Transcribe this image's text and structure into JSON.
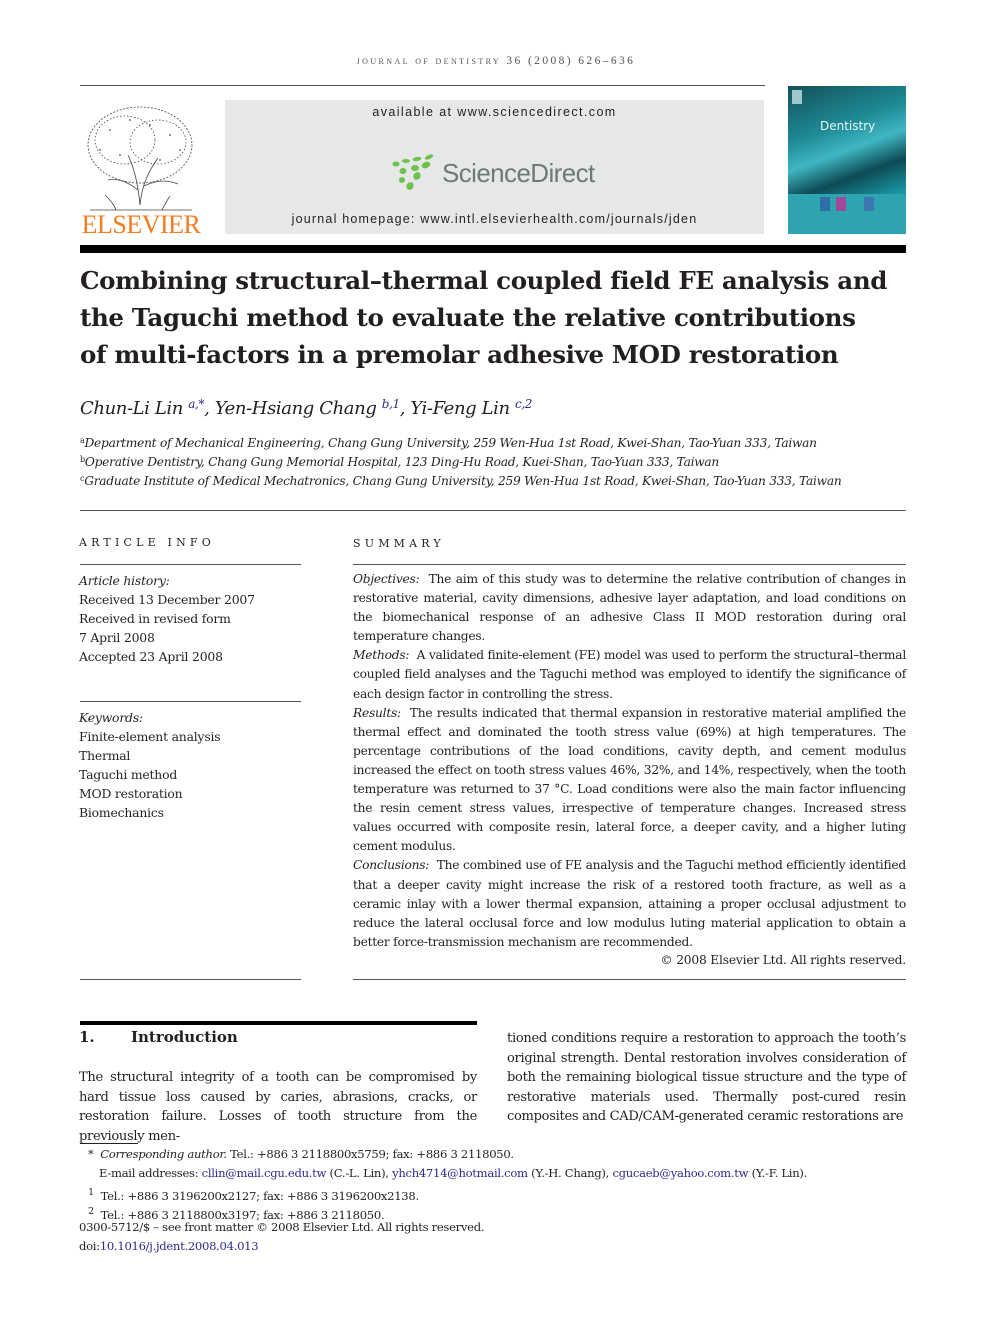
{
  "header": {
    "running_head": "journal of dentistry 36 (2008) 626–636",
    "publisher_word": "ELSEVIER",
    "available_at": "available at www.sciencedirect.com",
    "sciencedirect_logo": "ScienceDirect",
    "homepage": "journal homepage: www.intl.elsevierhealth.com/journals/jden",
    "cover_title": "Dentistry",
    "colors": {
      "elsevier_orange": "#f47b20",
      "sd_green": "#6cc24a",
      "sd_grey": "#6d7a76",
      "cover_teal": "#1d8a95",
      "link_blue": "#2b2b8c"
    }
  },
  "article": {
    "title_lines": [
      "Combining structural–thermal coupled field FE analysis and",
      "the Taguchi method to evaluate the relative contributions",
      "of multi-factors in a premolar adhesive MOD restoration"
    ],
    "authors": [
      {
        "name": "Chun-Li Lin",
        "sup": "a,*",
        "sep": ", "
      },
      {
        "name": "Yen-Hsiang Chang",
        "sup": "b,1",
        "sep": ", "
      },
      {
        "name": "Yi-Feng Lin",
        "sup": "c,2",
        "sep": ""
      }
    ],
    "affiliations": [
      {
        "mark": "a",
        "text": "Department of Mechanical Engineering, Chang Gung University, 259 Wen-Hua 1st Road, Kwei-Shan, Tao-Yuan 333, Taiwan"
      },
      {
        "mark": "b",
        "text": "Operative Dentistry, Chang Gung Memorial Hospital, 123 Ding-Hu Road, Kuei-Shan, Tao-Yuan 333, Taiwan"
      },
      {
        "mark": "c",
        "text": "Graduate Institute of Medical Mechatronics, Chang Gung University, 259 Wen-Hua 1st Road, Kwei-Shan, Tao-Yuan 333, Taiwan"
      }
    ]
  },
  "article_info": {
    "heading": "ARTICLE INFO",
    "history_label": "Article history:",
    "history": [
      "Received 13 December 2007",
      "Received in revised form",
      "7 April 2008",
      "Accepted 23 April 2008"
    ],
    "keywords_label": "Keywords:",
    "keywords": [
      "Finite-element analysis",
      "Thermal",
      "Taguchi method",
      "MOD restoration",
      "Biomechanics"
    ]
  },
  "summary": {
    "heading": "SUMMARY",
    "sections": [
      {
        "label": "Objectives:",
        "text": "The aim of this study was to determine the relative contribution of changes in restorative material, cavity dimensions, adhesive layer adaptation, and load conditions on the biomechanical response of an adhesive Class II MOD restoration during oral temperature changes."
      },
      {
        "label": "Methods:",
        "text": "A validated finite-element (FE) model was used to perform the structural–thermal coupled field analyses and the Taguchi method was employed to identify the significance of each design factor in controlling the stress."
      },
      {
        "label": "Results:",
        "text": "The results indicated that thermal expansion in restorative material amplified the thermal effect and dominated the tooth stress value (69%) at high temperatures. The percentage contributions of the load conditions, cavity depth, and cement modulus increased the effect on tooth stress values 46%, 32%, and 14%, respectively, when the tooth temperature was returned to 37 °C. Load conditions were also the main factor influencing the resin cement stress values, irrespective of temperature changes. Increased stress values occurred with composite resin, lateral force, a deeper cavity, and a higher luting cement modulus."
      },
      {
        "label": "Conclusions:",
        "text": "The combined use of FE analysis and the Taguchi method efficiently identified that a deeper cavity might increase the risk of a restored tooth fracture, as well as a ceramic inlay with a lower thermal expansion, attaining a proper occlusal adjustment to reduce the lateral occlusal force and low modulus luting material application to obtain a better force-transmission mechanism are recommended."
      }
    ],
    "copyright": "© 2008 Elsevier Ltd. All rights reserved."
  },
  "introduction": {
    "number": "1.",
    "heading": "Introduction",
    "left_text": "The structural integrity of a tooth can be compromised by hard tissue loss caused by caries, abrasions, cracks, or restoration failure. Losses of tooth structure from the previously men-",
    "right_text": "tioned conditions require a restoration to approach the tooth’s original strength. Dental restoration involves consideration of both the remaining biological tissue structure and the type of restorative materials used. Thermally post-cured resin composites and CAD/CAM-generated ceramic restorations are"
  },
  "footnotes": {
    "corresponding_mark": "*",
    "corresponding_label": "Corresponding author.",
    "corresponding_text": "Tel.: +886 3 2118800x5759; fax: +886 3 2118050.",
    "email_label": "E-mail addresses:",
    "emails": [
      {
        "address": "cllin@mail.cgu.edu.tw",
        "who": "(C.-L. Lin),"
      },
      {
        "address": "yhch4714@hotmail.com",
        "who": "(Y.-H. Chang),"
      },
      {
        "address": "cgucaeb@yahoo.com.tw",
        "who": "(Y.-F. Lin)."
      }
    ],
    "fn1_mark": "1",
    "fn1": "Tel.: +886 3 3196200x2127; fax: +886 3 3196200x2138.",
    "fn2_mark": "2",
    "fn2": "Tel.: +886 3 2118800x3197; fax: +886 3 2118050.",
    "front_matter": "0300-5712/$ – see front matter © 2008 Elsevier Ltd. All rights reserved.",
    "doi_prefix": "doi:",
    "doi": "10.1016/j.jdent.2008.04.013"
  }
}
